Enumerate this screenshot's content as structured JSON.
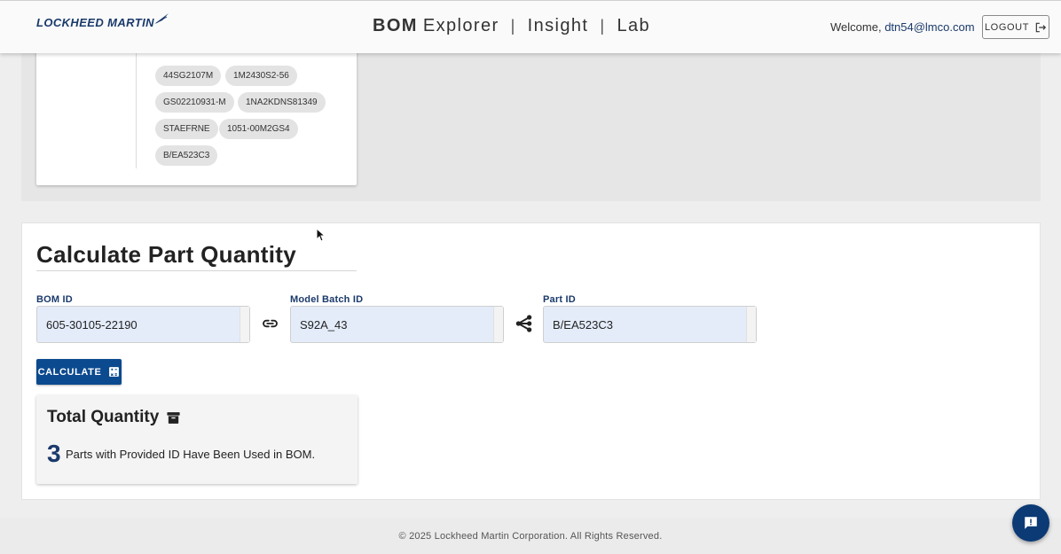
{
  "header": {
    "logo_text": "LOCKHEED MARTIN",
    "nav": {
      "brand_bold": "BOM",
      "brand_rest": "Explorer",
      "separator": "|",
      "insight": "Insight",
      "lab": "Lab"
    },
    "welcome_prefix": "Welcome,",
    "user_email": "dtn54@lmco.com",
    "logout_label": "LOGOUT"
  },
  "part_ids": [
    "44SG2107M",
    "1M2430S2-56",
    "GS02210931-M",
    "1NA2KDNS81349",
    "STAEFRNE",
    "1051-00M2GS4",
    "B/EA523C3"
  ],
  "calculate": {
    "title": "Calculate Part Quantity",
    "bom_id_label": "BOM ID",
    "bom_id_value": "605-30105-22190",
    "model_batch_label": "Model Batch ID",
    "model_batch_value": "S92A_43",
    "part_id_label": "Part ID",
    "part_id_value": "B/EA523C3",
    "button_label": "CALCULATE",
    "link_icon": "link-icon",
    "tree_icon": "share-tree-icon"
  },
  "total": {
    "title": "Total Quantity",
    "value": "3",
    "description": "Parts with Provided ID Have Been Used in BOM."
  },
  "footer": {
    "copyright": "© 2025 Lockheed Martin Corporation. All Rights Reserved."
  },
  "colors": {
    "brand_navy": "#1a3a6b",
    "button_blue": "#0b4a8f",
    "field_bg": "#e4ecfa"
  }
}
